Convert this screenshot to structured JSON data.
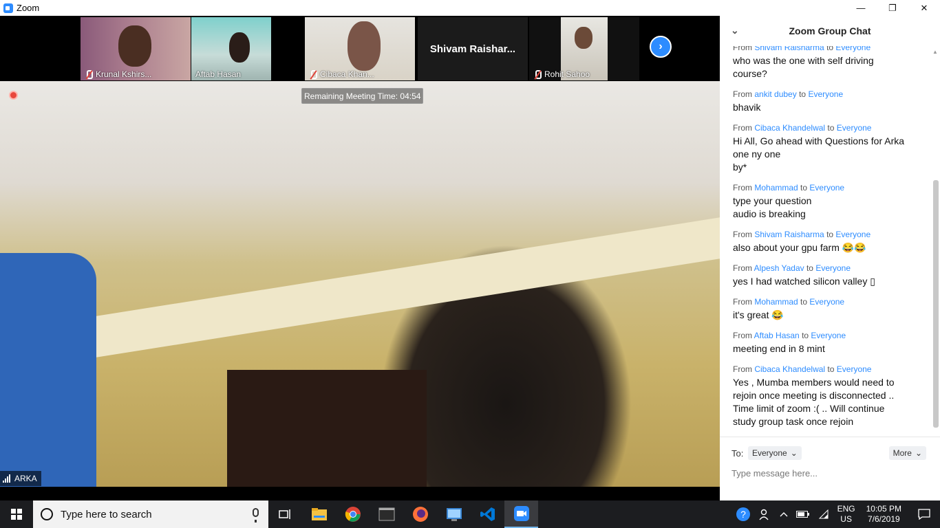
{
  "window": {
    "title": "Zoom",
    "minimize": "—",
    "restore": "❐",
    "close": "✕"
  },
  "participants": [
    {
      "name": "Krunal Kshirs...",
      "muted": true
    },
    {
      "name": "Aftab Hasan",
      "muted": false
    },
    {
      "name": "Cibaca Khan...",
      "muted": true
    },
    {
      "name": "Shivam  Raishar...",
      "muted": false
    },
    {
      "name": "Rohit Sahoo",
      "muted": true
    }
  ],
  "next_button": "›",
  "meeting": {
    "remaining_time": "Remaining Meeting Time: 04:54",
    "active_speaker": "ARKA"
  },
  "chat": {
    "title": "Zoom Group Chat",
    "collapse_icon": "⌄",
    "messages": [
      {
        "from": "Shivam Raisharma",
        "to": "Everyone",
        "lines": [
          "who was the one with self driving",
          "course?"
        ]
      },
      {
        "from": "ankit dubey",
        "to": "Everyone",
        "lines": [
          "bhavik"
        ]
      },
      {
        "from": "Cibaca Khandelwal",
        "to": "Everyone",
        "lines": [
          "Hi All, Go ahead with Questions for Arka",
          "one ny one",
          "by*"
        ]
      },
      {
        "from": "Mohammad",
        "to": "Everyone",
        "lines": [
          "type your question",
          "audio is breaking"
        ]
      },
      {
        "from": "Shivam Raisharma",
        "to": "Everyone",
        "lines": [
          "also about your gpu farm 😂😂"
        ]
      },
      {
        "from": "Alpesh Yadav",
        "to": "Everyone",
        "lines": [
          "yes I had watched silicon valley ▯"
        ]
      },
      {
        "from": "Mohammad",
        "to": "Everyone",
        "lines": [
          "it's great 😂"
        ]
      },
      {
        "from": "Aftab Hasan",
        "to": "Everyone",
        "lines": [
          "meeting end in 8 mint"
        ]
      },
      {
        "from": "Cibaca Khandelwal",
        "to": "Everyone",
        "lines": [
          "Yes , Mumba members would need to",
          "rejoin once meeting is disconnected ..",
          "Time limit of zoom :( .. Will continue",
          "study group task once rejoin"
        ]
      }
    ],
    "from_word": "From",
    "to_word": "to",
    "to_label": "To:",
    "to_value": "Everyone",
    "more_label": "More",
    "input_placeholder": "Type message here..."
  },
  "taskbar": {
    "search_placeholder": "Type here to search",
    "language": "ENG",
    "region": "US",
    "time": "10:05 PM",
    "date": "7/6/2019"
  },
  "colors": {
    "zoom_blue": "#2d8cff",
    "taskbar": "#1c1d20",
    "mute_red": "#e0453b"
  }
}
